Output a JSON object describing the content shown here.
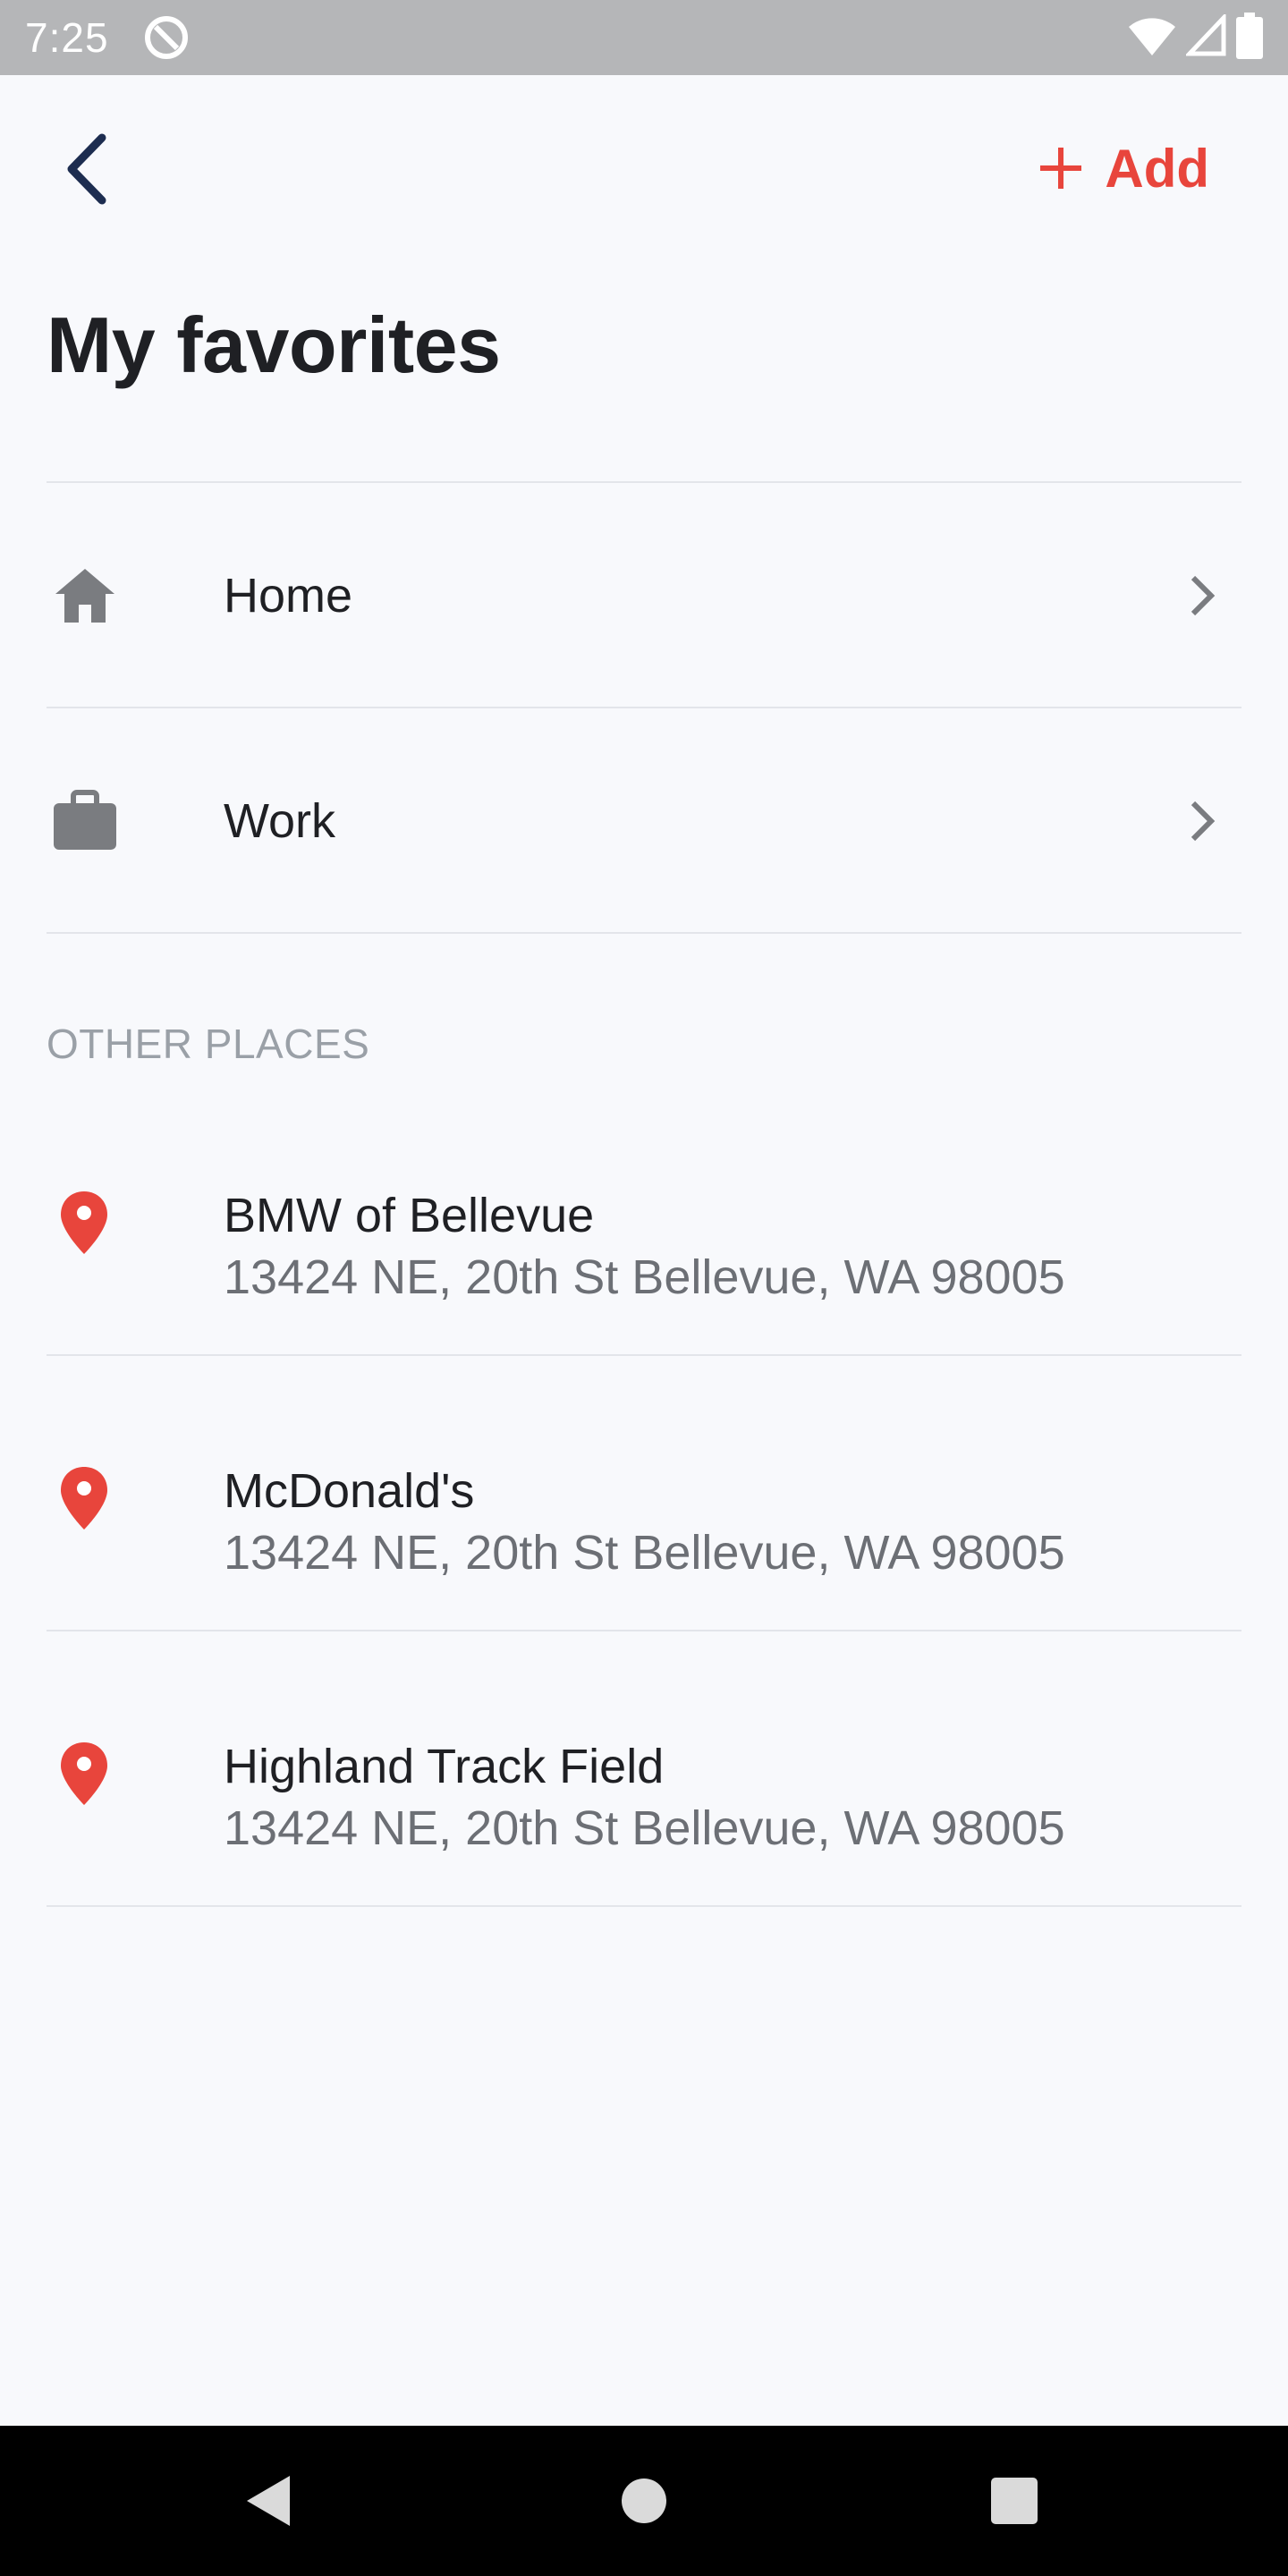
{
  "status_bar": {
    "time": "7:25",
    "icons": [
      "app-notification-icon",
      "wifi-icon",
      "cellular-signal-icon",
      "battery-icon"
    ]
  },
  "header": {
    "back_icon": "chevron-left-icon",
    "add_label": "Add",
    "add_icon": "plus-icon",
    "title": "My favorites"
  },
  "favorites": [
    {
      "label": "Home",
      "icon": "home-icon"
    },
    {
      "label": "Work",
      "icon": "briefcase-icon"
    }
  ],
  "other_places": {
    "header": "OTHER PLACES",
    "items": [
      {
        "name": "BMW of Bellevue",
        "address": "13424 NE, 20th St Bellevue, WA 98005",
        "icon": "map-pin-icon"
      },
      {
        "name": "McDonald's",
        "address": "13424 NE, 20th St Bellevue, WA 98005",
        "icon": "map-pin-icon"
      },
      {
        "name": "Highland Track Field",
        "address": "13424 NE, 20th St Bellevue, WA 98005",
        "icon": "map-pin-icon"
      }
    ]
  },
  "nav_bar": {
    "icons": [
      "nav-back-icon",
      "nav-home-icon",
      "nav-recents-icon"
    ]
  },
  "colors": {
    "accent": "#e8453c",
    "back_chevron": "#1d2d50",
    "icon_gray": "#7a7c80",
    "background": "#f8f9fc",
    "status_bar": "#b5b6b8"
  }
}
